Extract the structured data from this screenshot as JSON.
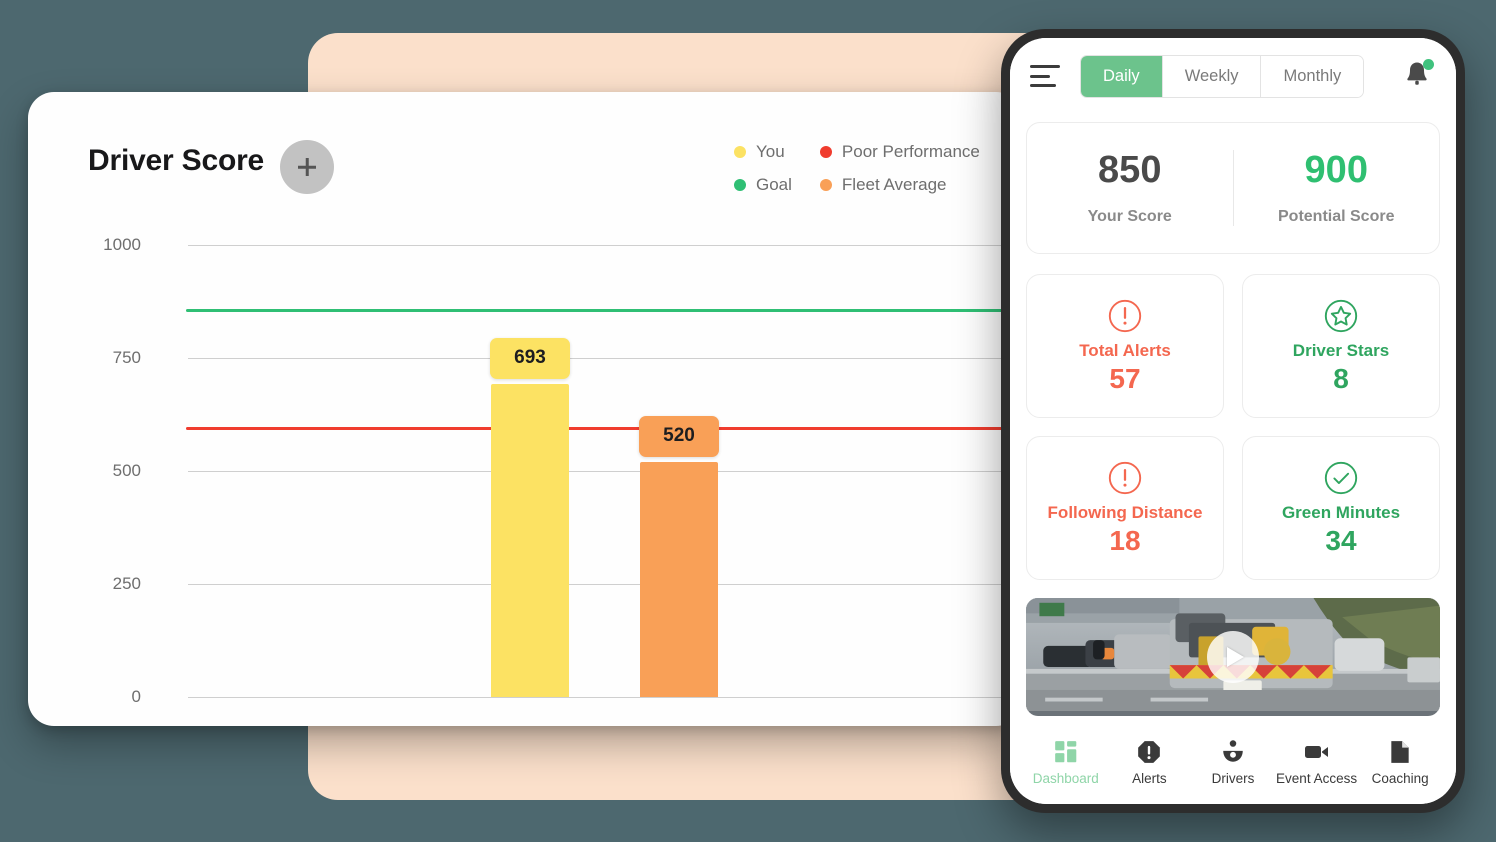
{
  "colors": {
    "background": "#4d686f",
    "peach_panel": "#fbe0cb",
    "you_yellow": "#fce263",
    "fleet_orange": "#f9a057",
    "goal_green": "#2fbf74",
    "poor_red": "#f03c2e",
    "accent_green": "#2fbf71",
    "alert_coral": "#f4674f",
    "tab_active_green": "#6cc38c"
  },
  "chart_card": {
    "title": "Driver Score",
    "add_button_label": "+",
    "legend": [
      {
        "label": "You",
        "color": "#fce263"
      },
      {
        "label": "Poor Performance",
        "color": "#f03c2e"
      },
      {
        "label": "Goal",
        "color": "#2fbf74"
      },
      {
        "label": "Fleet Average",
        "color": "#f9a057"
      }
    ]
  },
  "chart_data": {
    "type": "bar",
    "title": "Driver Score",
    "xlabel": "",
    "ylabel": "",
    "ylim": [
      0,
      1000
    ],
    "yticks": [
      0,
      250,
      500,
      750,
      1000
    ],
    "ytick_labels": [
      "0",
      "250",
      "500",
      "750",
      "1000"
    ],
    "grid": true,
    "legend_position": "top-right",
    "categories": [
      "You",
      "Fleet Average"
    ],
    "series": [
      {
        "name": "You",
        "values": [
          693,
          null
        ],
        "color": "#fce263"
      },
      {
        "name": "Fleet Average",
        "values": [
          null,
          520
        ],
        "color": "#f9a057"
      }
    ],
    "bars": [
      {
        "name": "You",
        "value": 693,
        "label": "693",
        "color": "#fce263"
      },
      {
        "name": "Fleet Average",
        "value": 520,
        "label": "520",
        "color": "#f9a057"
      }
    ],
    "reference_lines": [
      {
        "name": "Goal",
        "value": 855,
        "color": "#2fbf74"
      },
      {
        "name": "Poor Performance",
        "value": 593,
        "color": "#f03c2e"
      }
    ]
  },
  "phone": {
    "menu_icon": "hamburger-icon",
    "period_tabs": [
      {
        "label": "Daily",
        "active": true
      },
      {
        "label": "Weekly",
        "active": false
      },
      {
        "label": "Monthly",
        "active": false
      }
    ],
    "notification_icon": "bell-icon",
    "has_notification": true,
    "scores": [
      {
        "value": "850",
        "label": "Your Score",
        "color": "#4a4a4a"
      },
      {
        "value": "900",
        "label": "Potential Score",
        "color": "#2fbf71"
      }
    ],
    "metrics": [
      {
        "icon": "exclamation-circle-icon",
        "name": "Total Alerts",
        "value": "57",
        "color": "#f4674f"
      },
      {
        "icon": "star-circle-icon",
        "name": "Driver Stars",
        "value": "8",
        "color": "#2fa55f"
      },
      {
        "icon": "exclamation-circle-icon",
        "name": "Following Distance",
        "value": "18",
        "color": "#f4674f"
      },
      {
        "icon": "check-circle-icon",
        "name": "Green Minutes",
        "value": "34",
        "color": "#2fa55f"
      }
    ],
    "video": {
      "play_icon": "play-icon"
    },
    "tabbar": [
      {
        "icon": "dashboard-grid-icon",
        "label": "Dashboard",
        "active": true
      },
      {
        "icon": "alert-octagon-icon",
        "label": "Alerts",
        "active": false
      },
      {
        "icon": "steering-wheel-icon",
        "label": "Drivers",
        "active": false
      },
      {
        "icon": "video-camera-icon",
        "label": "Event Access",
        "active": false
      },
      {
        "icon": "document-icon",
        "label": "Coaching",
        "active": false
      }
    ]
  }
}
